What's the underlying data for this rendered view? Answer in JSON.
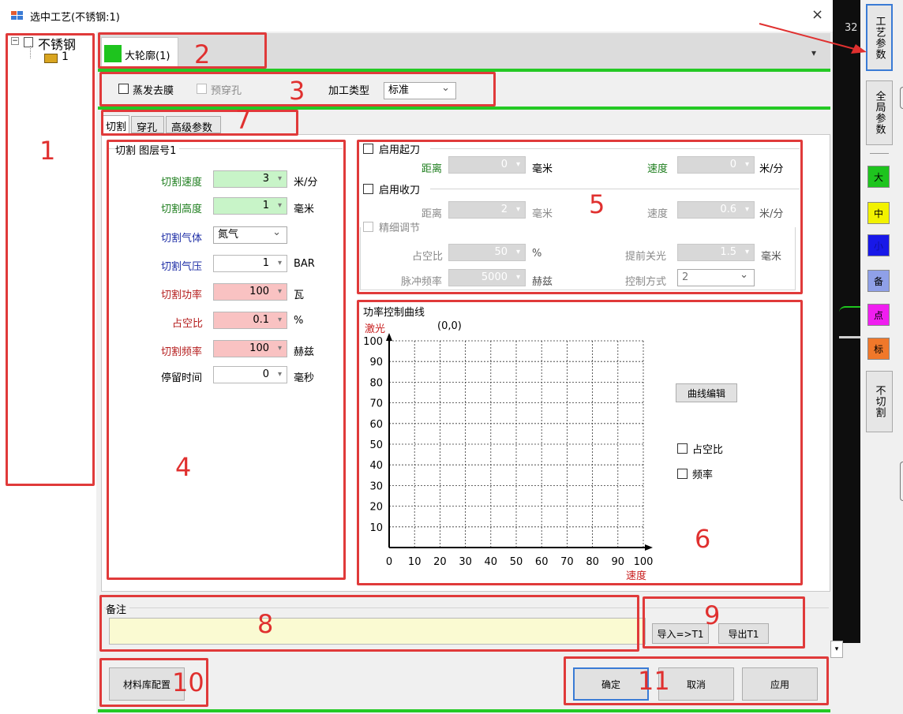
{
  "window": {
    "title": "选中工艺(不锈钢:1)",
    "close": "×"
  },
  "tree": {
    "root": "不锈钢",
    "child": "1"
  },
  "layer_tab": {
    "label": "大轮廓(1)",
    "color": "#1ec41e"
  },
  "options": {
    "evaporate": "蒸发去膜",
    "prepierce": "预穿孔",
    "process_type_label": "加工类型",
    "process_type_value": "标准"
  },
  "subtabs": [
    "切割",
    "穿孔",
    "高级参数"
  ],
  "cut_group": {
    "title": "切割 图层号1",
    "rows": [
      {
        "label": "切割速度",
        "value": "3",
        "unit": "米/分",
        "label_color": "#1e7e1e"
      },
      {
        "label": "切割高度",
        "value": "1",
        "unit": "毫米",
        "label_color": "#1e7e1e"
      },
      {
        "label": "切割气体",
        "value": "氮气",
        "unit": "",
        "label_color": "#1e2ea6"
      },
      {
        "label": "切割气压",
        "value": "1",
        "unit": "BAR",
        "label_color": "#1e2ea6"
      },
      {
        "label": "切割功率",
        "value": "100",
        "unit": "瓦",
        "label_color": "#b51e1e"
      },
      {
        "label": "占空比",
        "value": "0.1",
        "unit": "%",
        "label_color": "#b51e1e"
      },
      {
        "label": "切割频率",
        "value": "100",
        "unit": "赫兹",
        "label_color": "#b51e1e"
      },
      {
        "label": "停留时间",
        "value": "0",
        "unit": "毫秒",
        "label_color": "#000000"
      }
    ]
  },
  "knife": {
    "start_label": "启用起刀",
    "start_dist_label": "距离",
    "start_dist": "0",
    "start_dist_unit": "毫米",
    "start_speed_label": "速度",
    "start_speed": "0",
    "start_speed_unit": "米/分",
    "end_label": "启用收刀",
    "end_dist_label": "距离",
    "end_dist": "2",
    "end_dist_unit": "毫米",
    "end_speed_label": "速度",
    "end_speed": "0.6",
    "end_speed_unit": "米/分",
    "fine_label": "精细调节",
    "duty_label": "占空比",
    "duty": "50",
    "duty_unit": "%",
    "early_off_label": "提前关光",
    "early_off": "1.5",
    "early_off_unit": "毫米",
    "pulse_label": "脉冲频率",
    "pulse": "5000",
    "pulse_unit": "赫兹",
    "ctrl_label": "控制方式",
    "ctrl": "2"
  },
  "curve": {
    "title": "功率控制曲线",
    "edit_btn": "曲线编辑",
    "duty_cb": "占空比",
    "freq_cb": "频率"
  },
  "chart_data": {
    "type": "line",
    "title": "功率控制曲线",
    "ylabel": "激光",
    "xlabel": "速度",
    "annotation": "(0,0)",
    "xlim": [
      0,
      100
    ],
    "ylim": [
      0,
      100
    ],
    "xticks": [
      "0",
      "10",
      "20",
      "30",
      "40",
      "50",
      "60",
      "70",
      "80",
      "90",
      "100"
    ],
    "yticks": [
      "10",
      "20",
      "30",
      "40",
      "50",
      "60",
      "70",
      "80",
      "90",
      "100"
    ],
    "grid": true,
    "series": []
  },
  "note": {
    "label": "备注",
    "value": "",
    "import_btn": "导入=>T1",
    "export_btn": "导出T1"
  },
  "bottom": {
    "material_btn": "材料库配置",
    "ok": "确定",
    "cancel": "取消",
    "apply": "应用"
  },
  "right": {
    "process_param": "工艺参数",
    "global_param": "全局参数",
    "c_big": "大",
    "c_mid": "中",
    "c_small": "小",
    "c_spare": "备",
    "c_point": "点",
    "c_mark": "标",
    "nocut": "不切割",
    "num": "32"
  },
  "annotations": {
    "n1": "1",
    "n2": "2",
    "n3": "3",
    "n4": "4",
    "n5": "5",
    "n6": "6",
    "n7": "7",
    "n8": "8",
    "n9": "9",
    "n10": "10",
    "n11": "11"
  }
}
